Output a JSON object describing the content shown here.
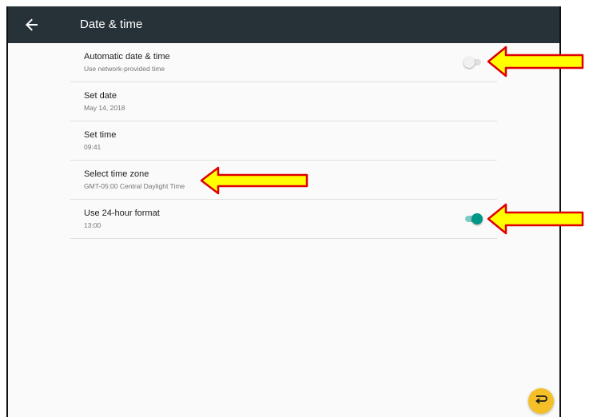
{
  "header": {
    "title": "Date & time",
    "back_icon": "arrow-back-icon"
  },
  "settings": [
    {
      "title": "Automatic date & time",
      "subtitle": "Use network-provided time",
      "toggle": "off"
    },
    {
      "title": "Set date",
      "subtitle": "May 14, 2018"
    },
    {
      "title": "Set time",
      "subtitle": "09:41"
    },
    {
      "title": "Select time zone",
      "subtitle": "GMT-05:00 Central Daylight Time"
    },
    {
      "title": "Use 24-hour format",
      "subtitle": "13:00",
      "toggle": "on"
    }
  ],
  "colors": {
    "toolbar": "#263238",
    "accent": "#009688",
    "annotation_arrow_fill": "#ffff00",
    "annotation_arrow_stroke": "#e00000",
    "fab": "#f5c027"
  },
  "fab_icon": "return-icon"
}
